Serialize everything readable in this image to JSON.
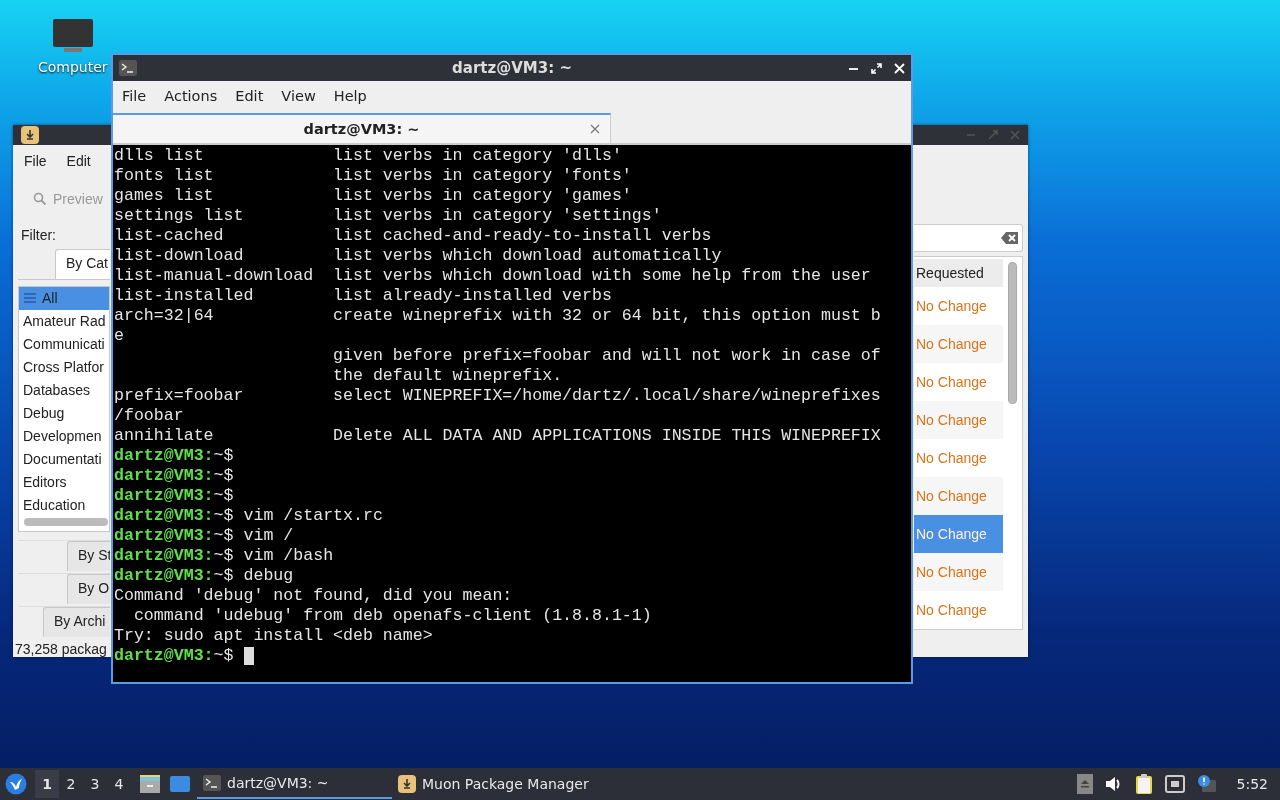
{
  "desktop": {
    "icons": [
      {
        "label": "Computer"
      }
    ]
  },
  "muon": {
    "menu": [
      "File",
      "Edit"
    ],
    "search_placeholder": "Preview",
    "filter_label": "Filter:",
    "top_tab": {
      "label": "By Cat",
      "selected": true
    },
    "categories": [
      {
        "label": "All",
        "selected": true
      },
      {
        "label": "Amateur Rad",
        "selected": false
      },
      {
        "label": "Communicati",
        "selected": false
      },
      {
        "label": "Cross Platfor",
        "selected": false
      },
      {
        "label": "Databases",
        "selected": false
      },
      {
        "label": "Debug",
        "selected": false
      },
      {
        "label": "Developmen",
        "selected": false
      },
      {
        "label": "Documentati",
        "selected": false
      },
      {
        "label": "Editors",
        "selected": false
      },
      {
        "label": "Education",
        "selected": false
      }
    ],
    "lower_tabs": [
      {
        "label": "By St",
        "selected": false
      },
      {
        "label": "By O",
        "selected": false
      },
      {
        "label": "By Archi",
        "selected": false
      }
    ],
    "status": "73,258 packag",
    "table": {
      "columns": [
        "Requested"
      ],
      "rows": [
        {
          "requested": "No Change",
          "selected": false
        },
        {
          "requested": "No Change",
          "selected": false
        },
        {
          "requested": "No Change",
          "selected": false
        },
        {
          "requested": "No Change",
          "selected": false
        },
        {
          "requested": "No Change",
          "selected": false
        },
        {
          "requested": "No Change",
          "selected": false
        },
        {
          "requested": "No Change",
          "selected": true
        },
        {
          "requested": "No Change",
          "selected": false
        },
        {
          "requested": "No Change",
          "selected": false
        }
      ]
    }
  },
  "terminal": {
    "title": "dartz@VM3: ~",
    "menu": [
      "File",
      "Actions",
      "Edit",
      "View",
      "Help"
    ],
    "tab": "dartz@VM3: ~",
    "lines": [
      {
        "kind": "help",
        "verb": "dlls list",
        "desc": "list verbs in category 'dlls'"
      },
      {
        "kind": "help",
        "verb": "fonts list",
        "desc": "list verbs in category 'fonts'"
      },
      {
        "kind": "help",
        "verb": "games list",
        "desc": "list verbs in category 'games'"
      },
      {
        "kind": "help",
        "verb": "settings list",
        "desc": "list verbs in category 'settings'"
      },
      {
        "kind": "help",
        "verb": "list-cached",
        "desc": "list cached-and-ready-to-install verbs"
      },
      {
        "kind": "help",
        "verb": "list-download",
        "desc": "list verbs which download automatically"
      },
      {
        "kind": "help",
        "verb": "list-manual-download",
        "desc": "list verbs which download with some help from the user"
      },
      {
        "kind": "help",
        "verb": "list-installed",
        "desc": "list already-installed verbs"
      },
      {
        "kind": "help",
        "verb": "arch=32|64",
        "desc": "create wineprefix with 32 or 64 bit, this option must b"
      },
      {
        "kind": "output",
        "text": "e"
      },
      {
        "kind": "continuation",
        "desc": "given before prefix=foobar and will not work in case of"
      },
      {
        "kind": "continuation",
        "desc": "the default wineprefix."
      },
      {
        "kind": "help",
        "verb": "prefix=foobar",
        "desc": "select WINEPREFIX=/home/dartz/.local/share/wineprefixes"
      },
      {
        "kind": "output",
        "text": "/foobar"
      },
      {
        "kind": "help",
        "verb": "annihilate",
        "desc": "Delete ALL DATA AND APPLICATIONS INSIDE THIS WINEPREFIX"
      },
      {
        "kind": "prompt",
        "user": "dartz@VM3:",
        "path": "~$"
      },
      {
        "kind": "prompt",
        "user": "dartz@VM3:",
        "path": "~$"
      },
      {
        "kind": "prompt",
        "user": "dartz@VM3:",
        "path": "~$"
      },
      {
        "kind": "prompt",
        "user": "dartz@VM3:",
        "path": "~$",
        "command": "vim /startx.rc"
      },
      {
        "kind": "prompt",
        "user": "dartz@VM3:",
        "path": "~$",
        "command": "vim /"
      },
      {
        "kind": "prompt",
        "user": "dartz@VM3:",
        "path": "~$",
        "command": "vim /bash"
      },
      {
        "kind": "prompt",
        "user": "dartz@VM3:",
        "path": "~$",
        "command": "debug"
      },
      {
        "kind": "output",
        "text": "Command 'debug' not found, did you mean:"
      },
      {
        "kind": "output",
        "text": "  command 'udebug' from deb openafs-client (1.8.8.1-1)"
      },
      {
        "kind": "output",
        "text": "Try: sudo apt install <deb name>"
      },
      {
        "kind": "prompt",
        "user": "dartz@VM3:",
        "path": "~$",
        "cursor": true
      }
    ]
  },
  "taskbar": {
    "workspaces": [
      {
        "label": "1",
        "selected": true
      },
      {
        "label": "2",
        "selected": false
      },
      {
        "label": "3",
        "selected": false
      },
      {
        "label": "4",
        "selected": false
      }
    ],
    "tasks": [
      {
        "kind": "terminal",
        "label": "dartz@VM3: ~",
        "selected": true
      },
      {
        "kind": "package",
        "label": "Muon Package Manager",
        "selected": false
      }
    ],
    "clock": "5:52"
  }
}
